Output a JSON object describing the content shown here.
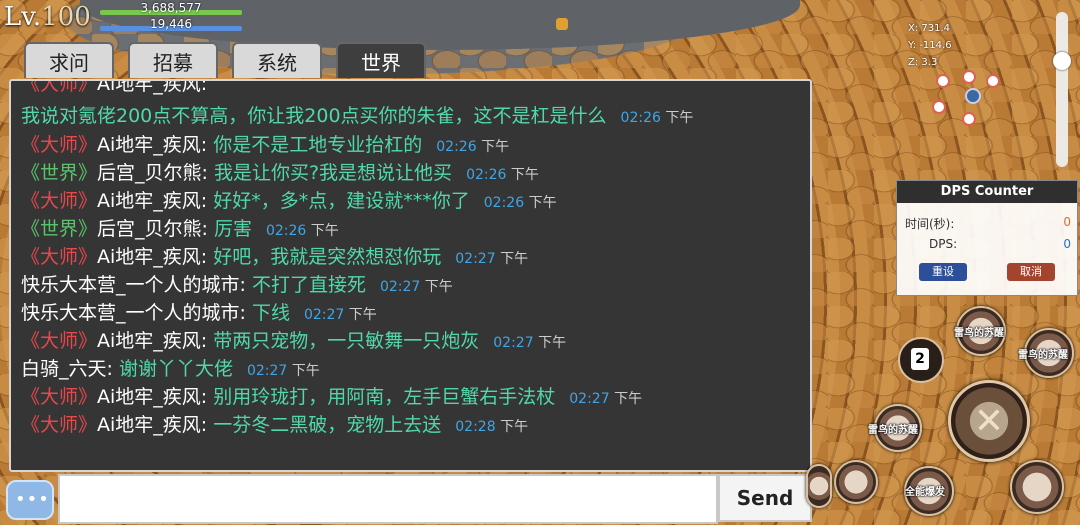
{
  "player": {
    "level_prefix": "Lv.",
    "level": "100",
    "hp": "3,688,577",
    "mp": "19,446"
  },
  "tabs": [
    "求问",
    "招募",
    "系统",
    "世界"
  ],
  "active_tab": "世界",
  "messages": [
    {
      "channel": "",
      "sender": "",
      "text": "我说对氪佬200点不算高，你让我200点买你的朱雀，这不是杠是什么",
      "time": "02:26",
      "ampm": "下午"
    },
    {
      "channel": "《大师》",
      "sender": "Ai地牢_疾风:",
      "text": "你是不是工地专业抬杠的",
      "time": "02:26",
      "ampm": "下午"
    },
    {
      "channel": "《世界》",
      "sender": "后宫_贝尔熊:",
      "text": "我是让你买?我是想说让他买",
      "time": "02:26",
      "ampm": "下午"
    },
    {
      "channel": "《大师》",
      "sender": "Ai地牢_疾风:",
      "text": "好好*，多*点，建设就***你了",
      "time": "02:26",
      "ampm": "下午"
    },
    {
      "channel": "《世界》",
      "sender": "后宫_贝尔熊:",
      "text": "厉害",
      "time": "02:26",
      "ampm": "下午"
    },
    {
      "channel": "《大师》",
      "sender": "Ai地牢_疾风:",
      "text": "好吧，我就是突然想怼你玩",
      "time": "02:27",
      "ampm": "下午"
    },
    {
      "channel": "",
      "sender": "快乐大本营_一个人的城市:",
      "text": "不打了直接死",
      "time": "02:27",
      "ampm": "下午"
    },
    {
      "channel": "",
      "sender": "快乐大本营_一个人的城市:",
      "text": "下线",
      "time": "02:27",
      "ampm": "下午"
    },
    {
      "channel": "《大师》",
      "sender": "Ai地牢_疾风:",
      "text": "带两只宠物，一只敏舞一只炮灰",
      "time": "02:27",
      "ampm": "下午"
    },
    {
      "channel": "",
      "sender": "白骑_六天:",
      "text": "谢谢丫丫大佬",
      "time": "02:27",
      "ampm": "下午"
    },
    {
      "channel": "《大师》",
      "sender": "Ai地牢_疾风:",
      "text": "别用玲珑打，用阿南，左手巨蟹右手法杖",
      "time": "02:27",
      "ampm": "下午"
    },
    {
      "channel": "《大师》",
      "sender": "Ai地牢_疾风:",
      "text": "一芬冬二黑破，宠物上去送",
      "time": "02:28",
      "ampm": "下午"
    }
  ],
  "partial_top": {
    "channel": "《大师》",
    "sender": "Ai地牢_疾风:"
  },
  "input": {
    "value": "",
    "send_label": "Send"
  },
  "coords": {
    "x": "X: 731.4",
    "y": "Y: -114.6",
    "z": "Z: 3.3"
  },
  "dps": {
    "title": "DPS Counter",
    "time_label": "时间(秒):",
    "time_value": "0",
    "dps_label": "DPS:",
    "dps_value": "0",
    "reset_label": "重设",
    "cancel_label": "取消"
  },
  "skills": {
    "skill_1": "雷鸟的苏醒",
    "skill_2": "雷鸟的苏醒",
    "skill_3": "雷鸟的苏醒",
    "skill_4": "全能爆发",
    "potion_count": "2"
  },
  "colors": {
    "master_channel": "#e8474b",
    "world_channel": "#59c46a",
    "message_text": "#4fd9a8",
    "time": "#3ea6e6"
  }
}
